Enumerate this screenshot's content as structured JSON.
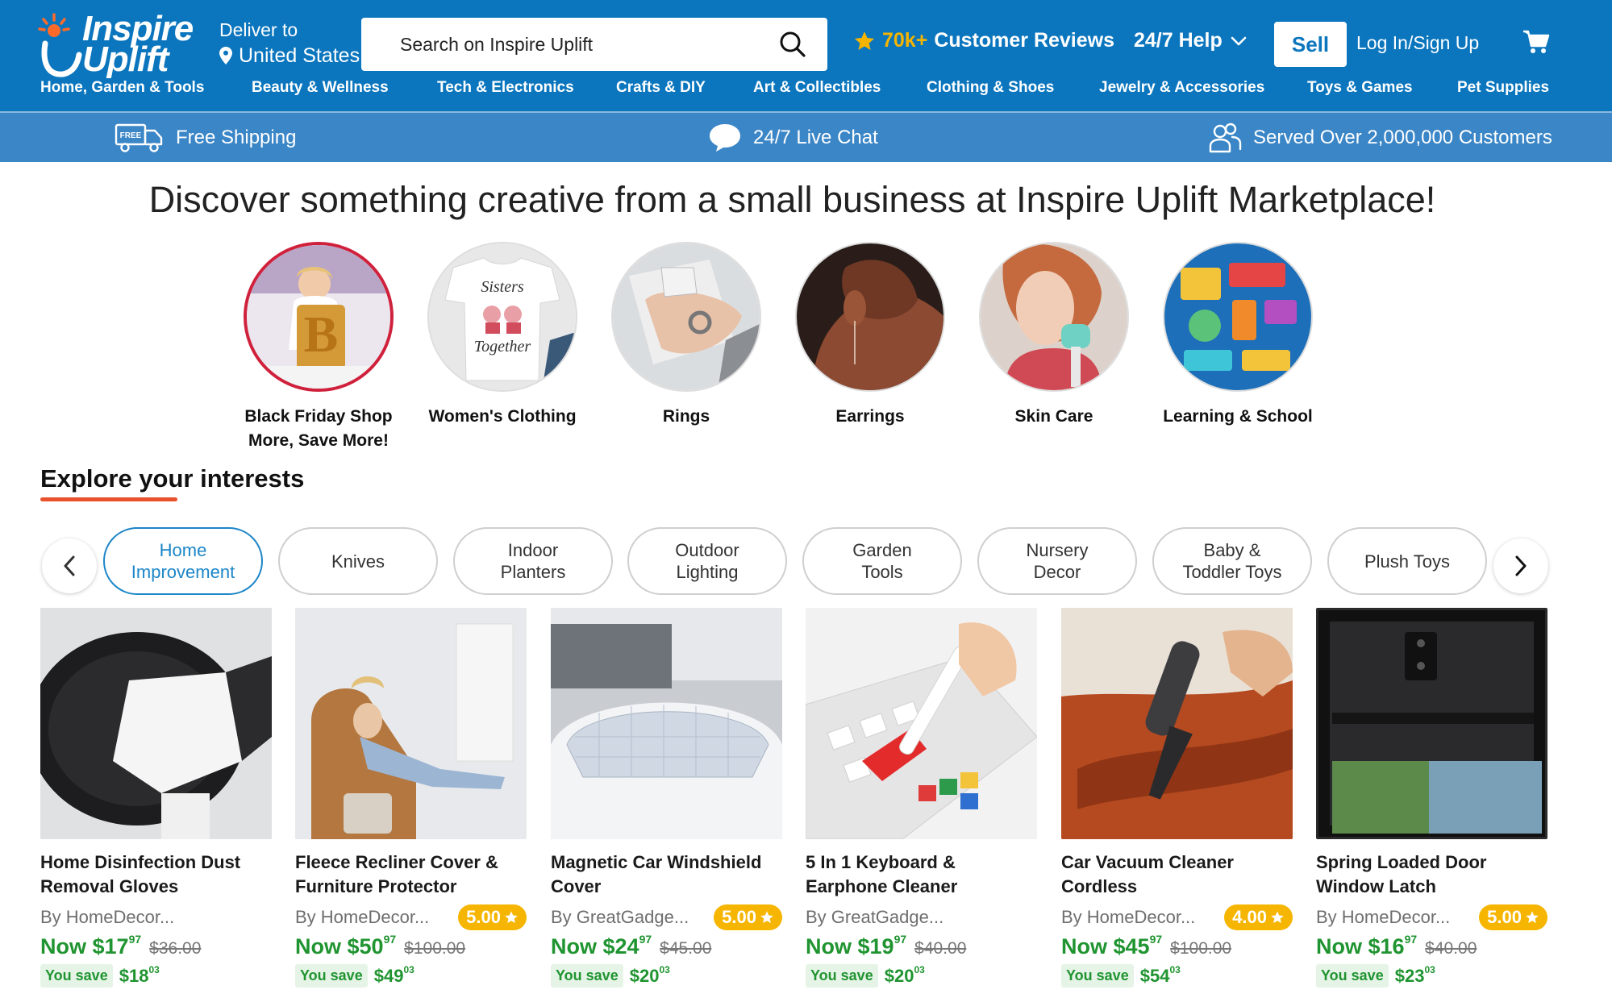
{
  "brand": {
    "line1": "Inspire",
    "line2": "Uplift"
  },
  "deliver": {
    "label": "Deliver to",
    "location": "United States"
  },
  "search": {
    "placeholder": "Search on Inspire Uplift"
  },
  "reviews": {
    "count": "70k+",
    "label": "Customer Reviews"
  },
  "help": {
    "label": "24/7 Help"
  },
  "sell": {
    "label": "Sell"
  },
  "login": {
    "label": "Log In/Sign Up"
  },
  "categories": [
    "Home, Garden & Tools",
    "Beauty & Wellness",
    "Tech & Electronics",
    "Crafts & DIY",
    "Art & Collectibles",
    "Clothing & Shoes",
    "Jewelry & Accessories",
    "Toys & Games",
    "Pet Supplies"
  ],
  "infobar": {
    "free_badge": "FREE",
    "shipping": "Free Shipping",
    "chat": "24/7 Live Chat",
    "served": "Served Over 2,000,000 Customers"
  },
  "hero": {
    "title": "Discover something creative from a small business at Inspire Uplift Marketplace!"
  },
  "featured": [
    {
      "label": "Black Friday Shop\nMore, Save More!"
    },
    {
      "label": "Women's Clothing",
      "shirt_line1": "Sisters",
      "shirt_line2": "Together"
    },
    {
      "label": "Rings"
    },
    {
      "label": "Earrings"
    },
    {
      "label": "Skin Care"
    },
    {
      "label": "Learning & School"
    }
  ],
  "explore": {
    "title": "Explore your interests"
  },
  "chips": [
    {
      "label": "Home\nImprovement",
      "active": true
    },
    {
      "label": "Knives"
    },
    {
      "label": "Indoor\nPlanters"
    },
    {
      "label": "Outdoor\nLighting"
    },
    {
      "label": "Garden\nTools"
    },
    {
      "label": "Nursery\nDecor"
    },
    {
      "label": "Baby &\nToddler Toys"
    },
    {
      "label": "Plush Toys"
    }
  ],
  "products": [
    {
      "name": "Home Disinfection Dust Removal Gloves",
      "by": "By HomeDecor...",
      "rating": "",
      "now_prefix": "Now",
      "now_dollars": "$17",
      "now_cents": "97",
      "was": "$36.00",
      "save_label": "You save",
      "save_dollars": "$18",
      "save_cents": "03"
    },
    {
      "name": "Fleece Recliner Cover & Furniture Protector",
      "by": "By HomeDecor...",
      "rating": "5.00",
      "now_prefix": "Now",
      "now_dollars": "$50",
      "now_cents": "97",
      "was": "$100.00",
      "save_label": "You save",
      "save_dollars": "$49",
      "save_cents": "03"
    },
    {
      "name": "Magnetic Car Windshield Cover",
      "by": "By GreatGadge...",
      "rating": "5.00",
      "now_prefix": "Now",
      "now_dollars": "$24",
      "now_cents": "97",
      "was": "$45.00",
      "save_label": "You save",
      "save_dollars": "$20",
      "save_cents": "03"
    },
    {
      "name": "5 In 1 Keyboard & Earphone Cleaner",
      "by": "By GreatGadge...",
      "rating": "",
      "now_prefix": "Now",
      "now_dollars": "$19",
      "now_cents": "97",
      "was": "$40.00",
      "save_label": "You save",
      "save_dollars": "$20",
      "save_cents": "03"
    },
    {
      "name": "Car Vacuum Cleaner Cordless",
      "by": "By HomeDecor...",
      "rating": "4.00",
      "now_prefix": "Now",
      "now_dollars": "$45",
      "now_cents": "97",
      "was": "$100.00",
      "save_label": "You save",
      "save_dollars": "$54",
      "save_cents": "03"
    },
    {
      "name": "Spring Loaded Door Window Latch",
      "by": "By HomeDecor...",
      "rating": "5.00",
      "now_prefix": "Now",
      "now_dollars": "$16",
      "now_cents": "97",
      "was": "$40.00",
      "save_label": "You save",
      "save_dollars": "$23",
      "save_cents": "03"
    }
  ],
  "colors": {
    "header_bg": "#0b76be",
    "infobar_bg": "#3b86c7",
    "accent_star": "#f5b400",
    "price_green": "#1f9430",
    "chip_active": "#1d86c8",
    "underline": "#e8512c"
  },
  "icons": [
    "sun-logo-icon",
    "location-pin-icon",
    "search-icon",
    "star-icon",
    "chevron-down-icon",
    "cart-icon",
    "truck-icon",
    "chat-bubble-icon",
    "users-icon",
    "chevron-left-icon",
    "chevron-right-icon"
  ]
}
